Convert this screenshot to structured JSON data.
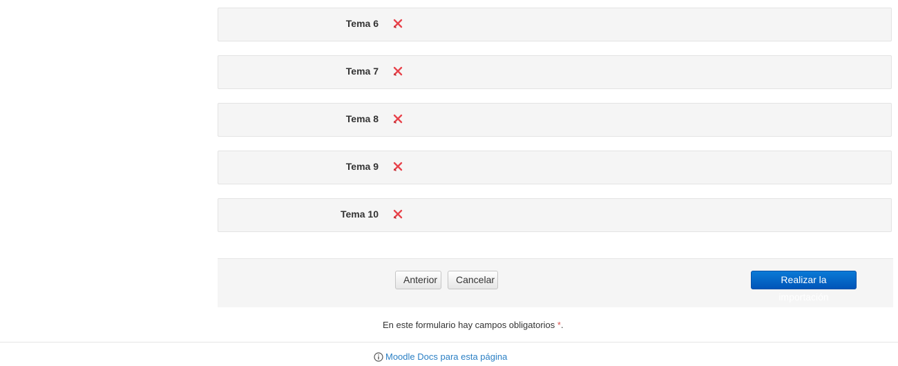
{
  "topics": [
    {
      "label": "Tema 6"
    },
    {
      "label": "Tema 7"
    },
    {
      "label": "Tema 8"
    },
    {
      "label": "Tema 9"
    },
    {
      "label": "Tema 10"
    }
  ],
  "topic_status_icon": "red-x-icon",
  "colors": {
    "excluded_icon": "#e8434b",
    "primary_button": "#0a6fcf",
    "link": "#2a7fc4",
    "required_star": "#d9534f"
  },
  "actions": {
    "previous_label": "Anterior",
    "cancel_label": "Cancelar",
    "submit_label": "Realizar la importación"
  },
  "form_note": {
    "text": "En este formulario hay campos obligatorios",
    "star": "*",
    "trailing": "."
  },
  "footer": {
    "docs_icon": "info-circle-icon",
    "docs_link": "Moodle Docs para esta página"
  }
}
